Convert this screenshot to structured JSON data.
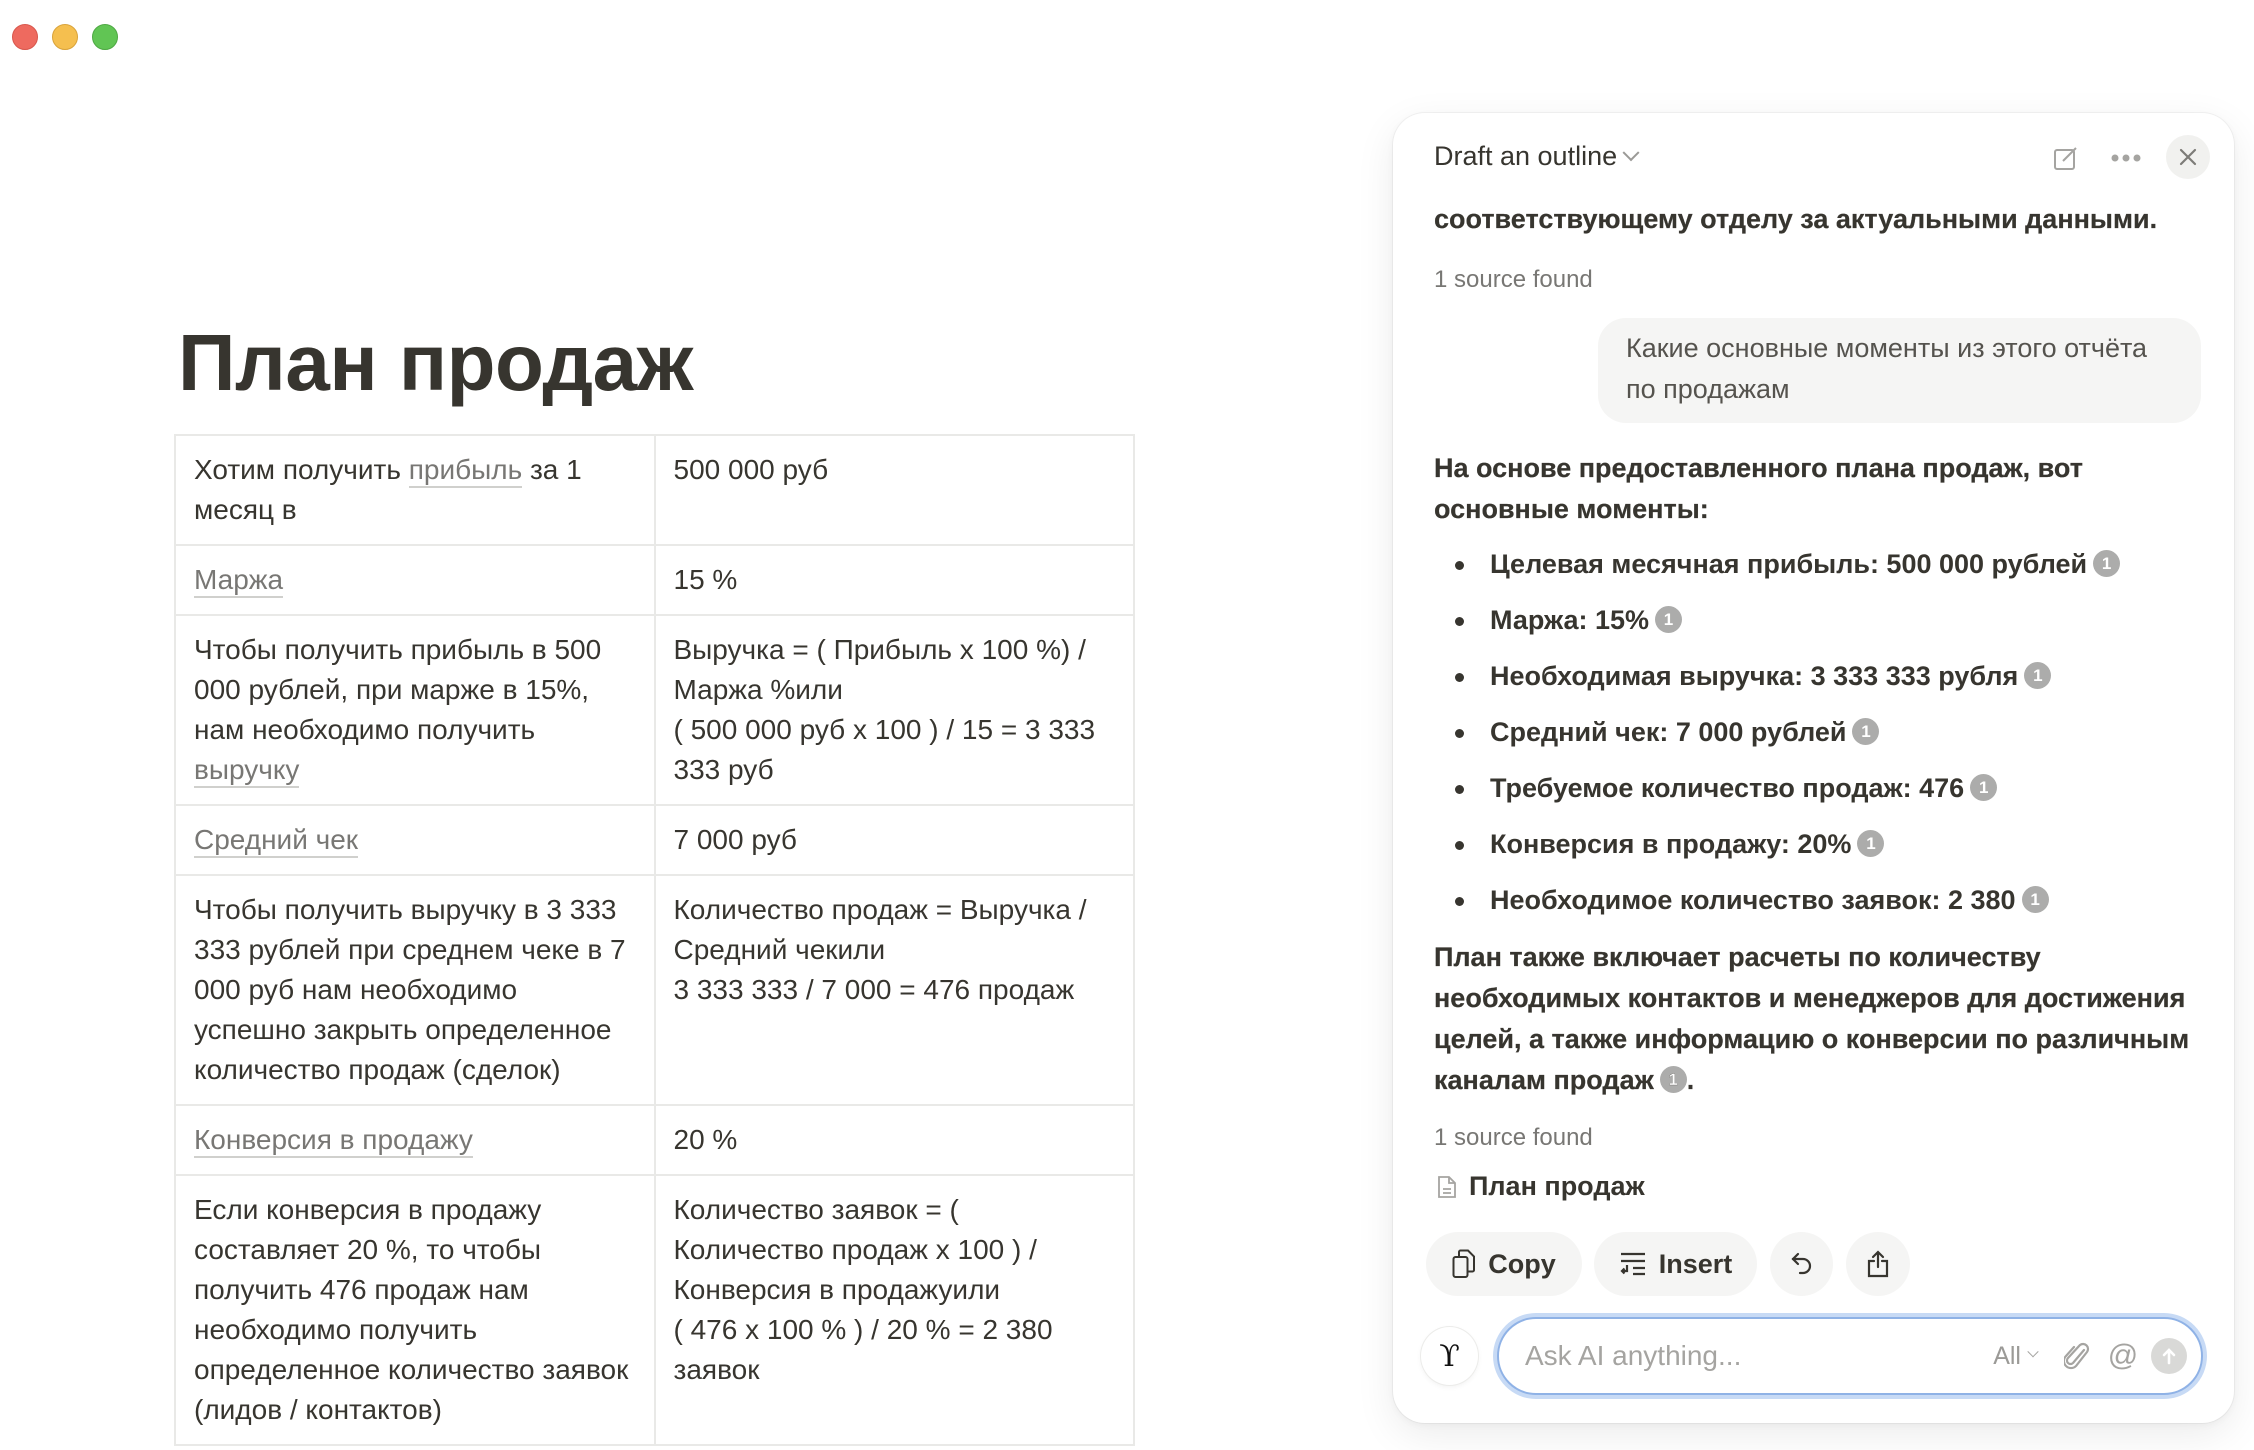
{
  "window": {
    "controls": [
      "close",
      "minimize",
      "zoom"
    ]
  },
  "page": {
    "title": "План продаж",
    "table": {
      "rows": [
        {
          "left": [
            {
              "text": "Хотим получить "
            },
            {
              "text": "прибыль",
              "link": true
            },
            {
              "text": " за 1 месяц в"
            }
          ],
          "right": [
            {
              "text": "500 000 руб"
            }
          ]
        },
        {
          "left": [
            {
              "text": "Маржа",
              "link": true
            }
          ],
          "right": [
            {
              "text": "15 %"
            }
          ]
        },
        {
          "left": [
            {
              "text": "Чтобы получить прибыль в 500 000 рублей, при марже в 15%, нам необходимо получить "
            },
            {
              "text": "выручку",
              "link": true
            }
          ],
          "right": [
            {
              "text": "Выручка = ( Прибыль х 100 %) / Маржа %или"
            },
            {
              "br": true
            },
            {
              "text": "( 500 000 руб х 100 ) / 15 = 3 333 333 руб"
            }
          ]
        },
        {
          "left": [
            {
              "text": "Средний чек",
              "link": true
            }
          ],
          "right": [
            {
              "text": "7 000 руб"
            }
          ]
        },
        {
          "left": [
            {
              "text": "Чтобы получить выручку в 3 333 333 рублей при среднем чеке в 7 000 руб нам необходимо успешно закрыть определенное количество продаж (сделок)"
            }
          ],
          "right": [
            {
              "text": "Количество продаж = Выручка / Средний чекили"
            },
            {
              "br": true
            },
            {
              "text": "3 333 333 / 7 000 = 476 продаж"
            }
          ]
        },
        {
          "left": [
            {
              "text": "Конверсия в продажу",
              "link": true
            }
          ],
          "right": [
            {
              "text": "20 %"
            }
          ]
        },
        {
          "left": [
            {
              "text": "Если конверсия в продажу составляет 20 %, то чтобы получить 476 продаж нам необходимо получить определенное количество заявок (лидов / контактов)"
            }
          ],
          "right": [
            {
              "text": "Количество заявок = ( Количество продаж х 100 ) / Конверсия в продажуили"
            },
            {
              "br": true
            },
            {
              "text": "( 476 х 100 % ) / 20 % = 2 380 заявок"
            }
          ]
        }
      ]
    }
  },
  "ai_panel": {
    "title": "Draft an outline",
    "header_icons": {
      "new_chat": "compose-icon",
      "more": "more-icon",
      "close": "close-icon"
    },
    "prev_answer_tail": "соответствующему отделу за актуальными данными.",
    "prev_sources_label": "1 source found",
    "user_message": "Какие основные моменты из этого отчёта по продажам",
    "answer": {
      "intro": "На основе предоставленного плана продаж, вот основные моменты:",
      "points": [
        {
          "text": "Целевая месячная прибыль: 500 000 рублей",
          "cite": "1"
        },
        {
          "text": "Маржа: 15%",
          "cite": "1"
        },
        {
          "text": "Необходимая выручка: 3 333 333 рубля",
          "cite": "1"
        },
        {
          "text": "Средний чек: 7 000 рублей",
          "cite": "1"
        },
        {
          "text": "Требуемое количество продаж: 476",
          "cite": "1"
        },
        {
          "text": "Конверсия в продажу: 20%",
          "cite": "1"
        },
        {
          "text": "Необходимое количество заявок: 2 380",
          "cite": "1"
        }
      ],
      "summary": "План также включает расчеты по количеству необходимых контактов и менеджеров для достижения целей, а также информацию о конверсии по различным каналам продаж",
      "summary_cite": "1",
      "summary_end": ".",
      "sources_label": "1 source found",
      "source_doc": "План продаж"
    },
    "actions": {
      "copy": "Copy",
      "insert": "Insert",
      "retry_icon": "undo-icon",
      "share_icon": "share-icon"
    },
    "composer": {
      "placeholder": "Ask AI anything...",
      "value": "",
      "scope": "All",
      "attach_icon": "paperclip-icon",
      "mention_icon": "at-icon",
      "send_icon": "arrow-up-icon"
    }
  }
}
